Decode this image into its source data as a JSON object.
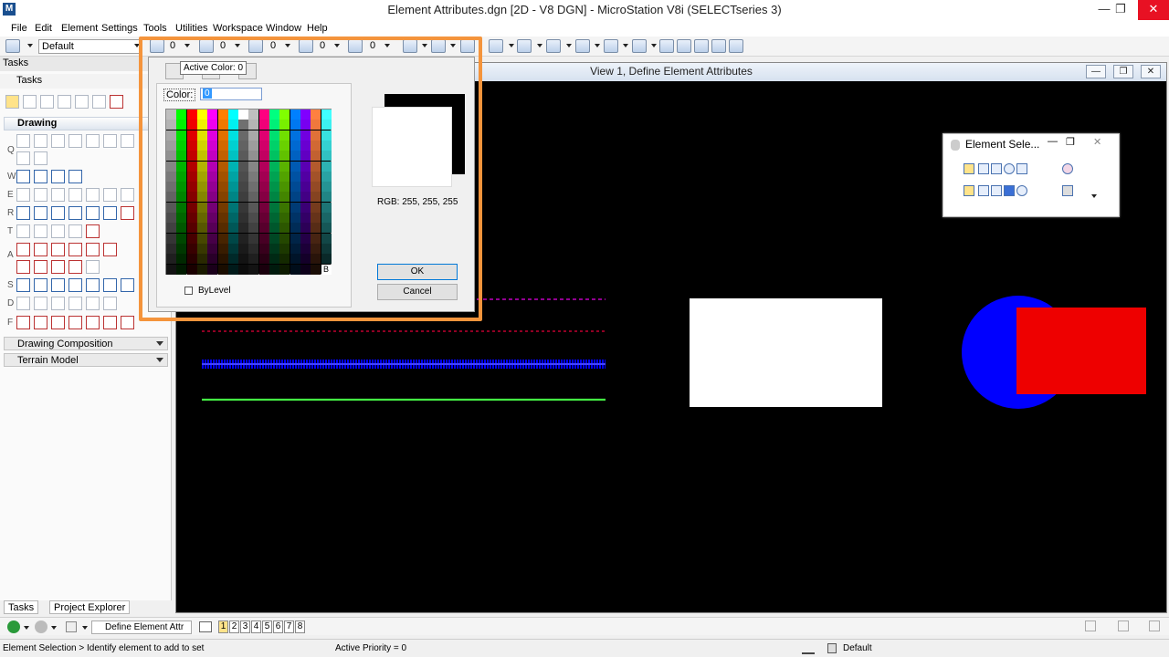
{
  "window": {
    "title": "Element Attributes.dgn [2D - V8 DGN] - MicroStation V8i (SELECTseries 3)",
    "app_icon": "M",
    "minimize": "—",
    "maximize": "❐",
    "close": "✕"
  },
  "menu": [
    "File",
    "Edit",
    "Element",
    "Settings",
    "Tools",
    "Utilities",
    "Workspace",
    "Window",
    "Help"
  ],
  "toolbar": {
    "level": "Default",
    "values": [
      "0",
      "0",
      "0",
      "0",
      "0"
    ]
  },
  "tasks": {
    "header": "Tasks",
    "subheader": "Tasks",
    "drawing_section": "Drawing",
    "row_letters": [
      "Q",
      "W",
      "E",
      "R",
      "T",
      "A",
      "S",
      "D",
      "F"
    ],
    "collapsed_sections": [
      "Drawing Composition",
      "Terrain Model"
    ],
    "tabs": [
      "Tasks",
      "Project Explorer"
    ]
  },
  "view": {
    "title": "View 1, Define Element Attributes"
  },
  "element_selection": {
    "title": "Element Sele...",
    "minimize": "—",
    "maximize": "❐",
    "close": "✕"
  },
  "color_dialog": {
    "tooltip": "Active Color: 0",
    "color_label": "Color:",
    "color_value": "0",
    "bylevel_label": "ByLevel",
    "rgb_text": "RGB: 255, 255, 255",
    "ok": "OK",
    "cancel": "Cancel",
    "last_swatch_label": "B"
  },
  "navbar": {
    "command": "Define Element Attr",
    "views": [
      "1",
      "2",
      "3",
      "4",
      "5",
      "6",
      "7",
      "8"
    ]
  },
  "status": {
    "prompt": "Element Selection > Identify element to add to set",
    "priority": "Active Priority = 0",
    "level": "Default"
  },
  "colors": {
    "highlight": "#f4943c",
    "purple_line": "#c000c0",
    "dark_red_line": "#c00030",
    "blue_line": "#0000ff",
    "green_line": "#44ee44",
    "white_rect": "#ffffff",
    "circle": "#0000ff",
    "red_rect": "#ee0000"
  }
}
